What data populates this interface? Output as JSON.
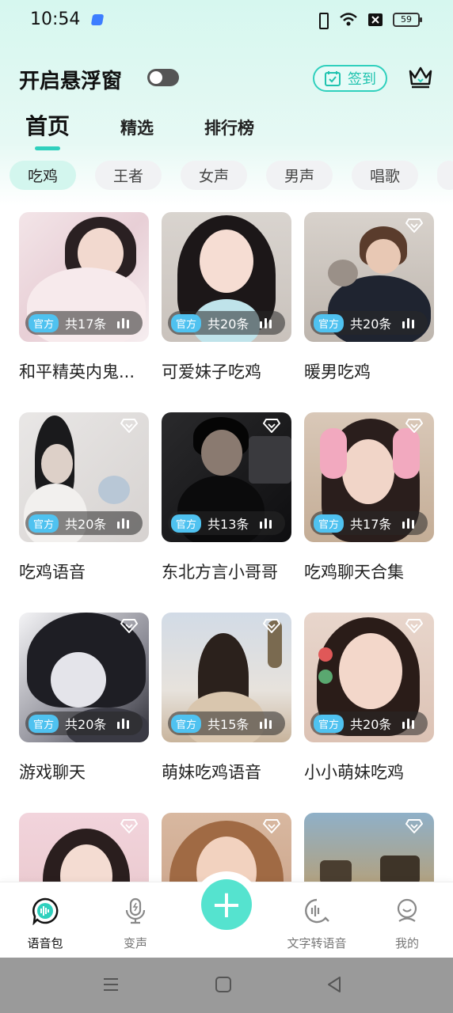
{
  "status_bar": {
    "time": "10:54",
    "battery": "59"
  },
  "header": {
    "float_window_label": "开启悬浮窗",
    "checkin_label": "签到"
  },
  "main_tabs": [
    {
      "label": "首页",
      "active": true
    },
    {
      "label": "精选",
      "active": false
    },
    {
      "label": "排行榜",
      "active": false
    }
  ],
  "chips": [
    "吃鸡",
    "王者",
    "女声",
    "男声",
    "唱歌"
  ],
  "cards": [
    {
      "title": "和平精英内鬼...",
      "tag": "官方",
      "count": "共17条",
      "vip": false
    },
    {
      "title": "可爱妹子吃鸡",
      "tag": "官方",
      "count": "共20条",
      "vip": false
    },
    {
      "title": "暖男吃鸡",
      "tag": "官方",
      "count": "共20条",
      "vip": true
    },
    {
      "title": "吃鸡语音",
      "tag": "官方",
      "count": "共20条",
      "vip": true
    },
    {
      "title": "东北方言小哥哥",
      "tag": "官方",
      "count": "共13条",
      "vip": true
    },
    {
      "title": "吃鸡聊天合集",
      "tag": "官方",
      "count": "共17条",
      "vip": true
    },
    {
      "title": "游戏聊天",
      "tag": "官方",
      "count": "共20条",
      "vip": true
    },
    {
      "title": "萌妹吃鸡语音",
      "tag": "官方",
      "count": "共15条",
      "vip": true
    },
    {
      "title": "小小萌妹吃鸡",
      "tag": "官方",
      "count": "共20条",
      "vip": true
    }
  ],
  "bottom_nav": [
    {
      "label": "语音包",
      "icon": "voice-pack-icon",
      "active": true
    },
    {
      "label": "变声",
      "icon": "mic-icon",
      "active": false
    },
    {
      "label": "文字转语音",
      "icon": "text-to-speech-icon",
      "active": false
    },
    {
      "label": "我的",
      "icon": "profile-icon",
      "active": false
    }
  ],
  "colors": {
    "accent": "#2fd0bd",
    "fab": "#55e3cf",
    "official_tag": "#4fc2f0"
  }
}
